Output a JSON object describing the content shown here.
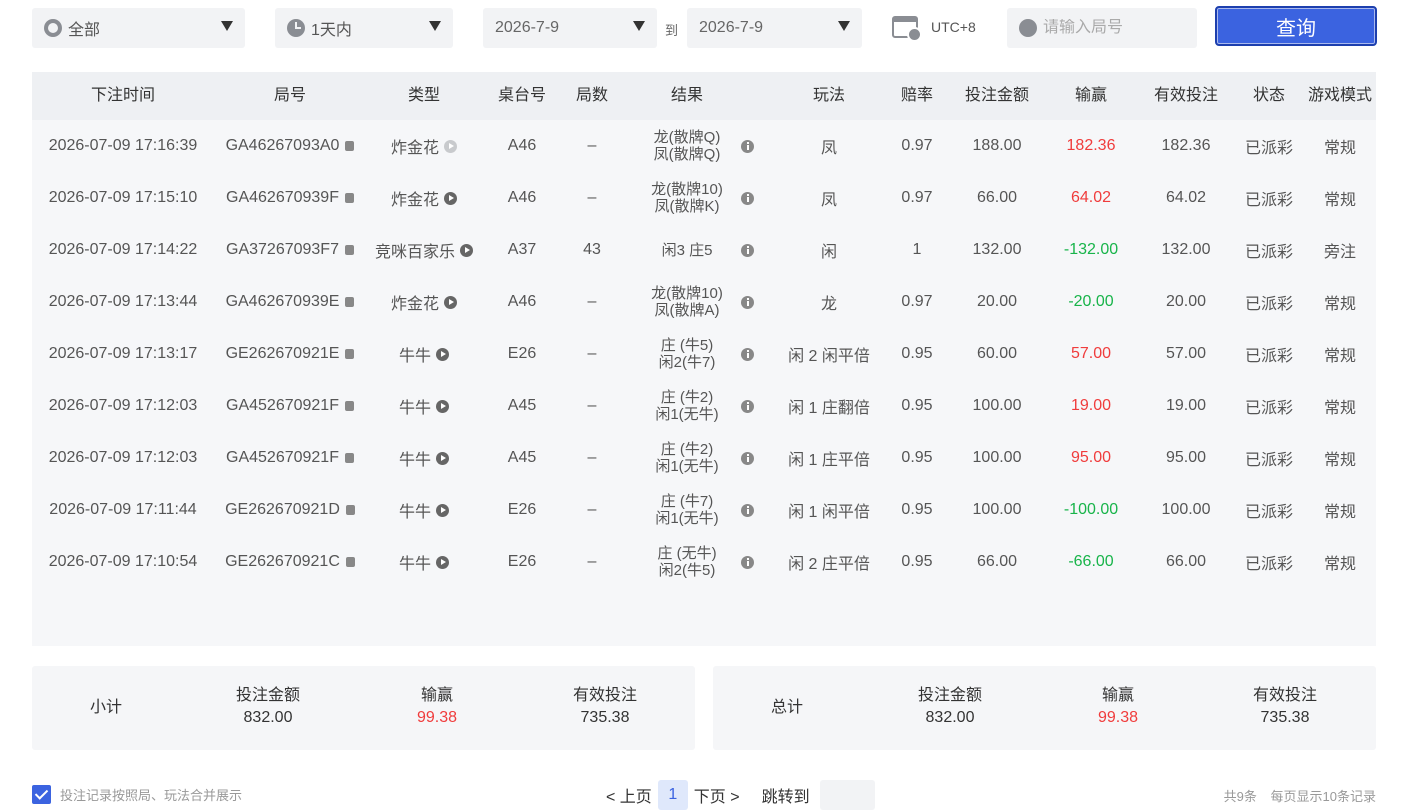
{
  "filters": {
    "game": "全部",
    "period": "1天内",
    "date_from": "2026-7-9",
    "to_label": "到",
    "date_to": "2026-7-9",
    "timezone": "UTC+8",
    "round_placeholder": "请输入局号",
    "query_label": "查询"
  },
  "table": {
    "headers": [
      "下注时间",
      "局号",
      "类型",
      "桌台号",
      "局数",
      "结果",
      "玩法",
      "赔率",
      "投注金额",
      "输赢",
      "有效投注",
      "状态",
      "游戏模式"
    ],
    "rows": [
      {
        "time": "2026-07-09 17:16:39",
        "round": "GA46267093A0",
        "type": "炸金花",
        "play_light": true,
        "table": "A46",
        "count": "–",
        "result1": "龙(散牌Q)",
        "result2": "凤(散牌Q)",
        "bet": "凤",
        "odds": "0.97",
        "amount": "188.00",
        "winloss": "182.36",
        "wl_color": "red",
        "valid": "182.36",
        "status": "已派彩",
        "mode": "常规"
      },
      {
        "time": "2026-07-09 17:15:10",
        "round": "GA462670939F",
        "type": "炸金花",
        "play_light": false,
        "table": "A46",
        "count": "–",
        "result1": "龙(散牌10)",
        "result2": "凤(散牌K)",
        "bet": "凤",
        "odds": "0.97",
        "amount": "66.00",
        "winloss": "64.02",
        "wl_color": "red",
        "valid": "64.02",
        "status": "已派彩",
        "mode": "常规"
      },
      {
        "time": "2026-07-09 17:14:22",
        "round": "GA37267093F7",
        "type": "竞咪百家乐",
        "play_light": false,
        "table": "A37",
        "count": "43",
        "result1": "闲3 庄5",
        "result2": "",
        "bet": "闲",
        "odds": "1",
        "amount": "132.00",
        "winloss": "-132.00",
        "wl_color": "green",
        "valid": "132.00",
        "status": "已派彩",
        "mode": "旁注"
      },
      {
        "time": "2026-07-09 17:13:44",
        "round": "GA462670939E",
        "type": "炸金花",
        "play_light": false,
        "table": "A46",
        "count": "–",
        "result1": "龙(散牌10)",
        "result2": "凤(散牌A)",
        "bet": "龙",
        "odds": "0.97",
        "amount": "20.00",
        "winloss": "-20.00",
        "wl_color": "green",
        "valid": "20.00",
        "status": "已派彩",
        "mode": "常规"
      },
      {
        "time": "2026-07-09 17:13:17",
        "round": "GE262670921E",
        "type": "牛牛",
        "play_light": false,
        "table": "E26",
        "count": "–",
        "result1": "庄 (牛5)",
        "result2": "闲2(牛7)",
        "bet": "闲 2 闲平倍",
        "odds": "0.95",
        "amount": "60.00",
        "winloss": "57.00",
        "wl_color": "red",
        "valid": "57.00",
        "status": "已派彩",
        "mode": "常规"
      },
      {
        "time": "2026-07-09 17:12:03",
        "round": "GA452670921F",
        "type": "牛牛",
        "play_light": false,
        "table": "A45",
        "count": "–",
        "result1": "庄 (牛2)",
        "result2": "闲1(无牛)",
        "bet": "闲 1 庄翻倍",
        "odds": "0.95",
        "amount": "100.00",
        "winloss": "19.00",
        "wl_color": "red",
        "valid": "19.00",
        "status": "已派彩",
        "mode": "常规"
      },
      {
        "time": "2026-07-09 17:12:03",
        "round": "GA452670921F",
        "type": "牛牛",
        "play_light": false,
        "table": "A45",
        "count": "–",
        "result1": "庄 (牛2)",
        "result2": "闲1(无牛)",
        "bet": "闲 1 庄平倍",
        "odds": "0.95",
        "amount": "100.00",
        "winloss": "95.00",
        "wl_color": "red",
        "valid": "95.00",
        "status": "已派彩",
        "mode": "常规"
      },
      {
        "time": "2026-07-09 17:11:44",
        "round": "GE262670921D",
        "type": "牛牛",
        "play_light": false,
        "table": "E26",
        "count": "–",
        "result1": "庄 (牛7)",
        "result2": "闲1(无牛)",
        "bet": "闲 1 闲平倍",
        "odds": "0.95",
        "amount": "100.00",
        "winloss": "-100.00",
        "wl_color": "green",
        "valid": "100.00",
        "status": "已派彩",
        "mode": "常规"
      },
      {
        "time": "2026-07-09 17:10:54",
        "round": "GE262670921C",
        "type": "牛牛",
        "play_light": false,
        "table": "E26",
        "count": "–",
        "result1": "庄 (无牛)",
        "result2": "闲2(牛5)",
        "bet": "闲 2 庄平倍",
        "odds": "0.95",
        "amount": "66.00",
        "winloss": "-66.00",
        "wl_color": "green",
        "valid": "66.00",
        "status": "已派彩",
        "mode": "常规"
      }
    ]
  },
  "subtotal": {
    "label": "小计",
    "amount_label": "投注金额",
    "amount": "832.00",
    "winloss_label": "输赢",
    "winloss": "99.38",
    "valid_label": "有效投注",
    "valid": "735.38"
  },
  "total": {
    "label": "总计",
    "amount_label": "投注金额",
    "amount": "832.00",
    "winloss_label": "输赢",
    "winloss": "99.38",
    "valid_label": "有效投注",
    "valid": "735.38"
  },
  "footer": {
    "merge_label": "投注记录按照局、玩法合并展示",
    "merge_checked": true,
    "prev_label": "< 上页",
    "current_page": "1",
    "next_label": "下页 >",
    "jump_label": "跳转到",
    "total_count": "共9条",
    "per_page": "每页显示10条记录"
  },
  "colors": {
    "accent": "#3b63e0",
    "win": "#f03c3c",
    "loss": "#18b44a"
  }
}
